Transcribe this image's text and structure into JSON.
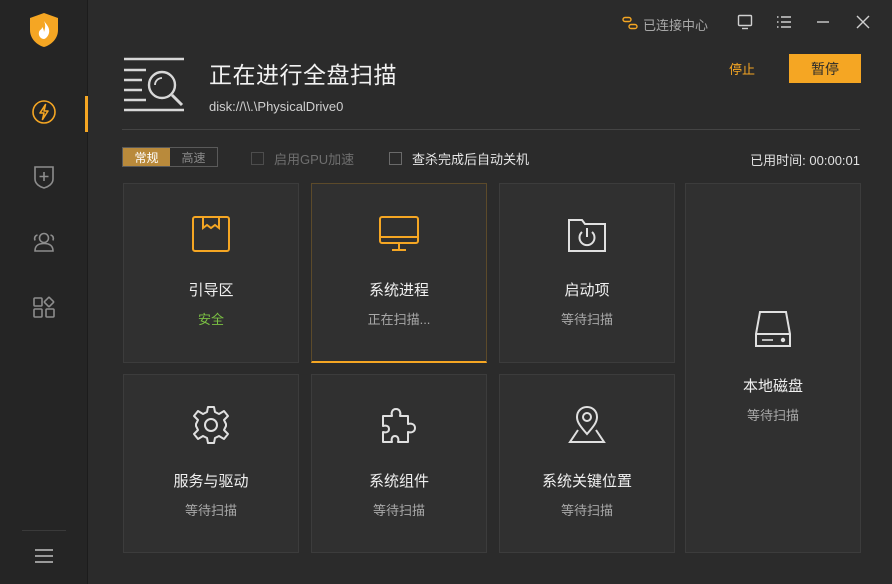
{
  "sidebar": {
    "items": [
      {
        "name": "scan",
        "icon": "lightning-icon",
        "active": true
      },
      {
        "name": "protection",
        "icon": "shield-plus-icon",
        "active": false
      },
      {
        "name": "accounts",
        "icon": "users-icon",
        "active": false
      },
      {
        "name": "tools",
        "icon": "apps-grid-icon",
        "active": false
      }
    ],
    "menu_icon": "hamburger-menu-icon"
  },
  "topbar": {
    "connect_label": "已连接中心"
  },
  "header": {
    "title": "正在进行全盘扫描",
    "path": "disk://\\\\.\\PhysicalDrive0",
    "stop_label": "停止",
    "pause_label": "暂停"
  },
  "options": {
    "modes": [
      "常规",
      "高速"
    ],
    "selected_mode": "常规",
    "gpu_label": "启用GPU加速",
    "shutdown_label": "查杀完成后自动关机",
    "elapsed_label": "已用时间:",
    "elapsed_value": "00:00:01"
  },
  "cards": [
    {
      "key": "boot",
      "name": "引导区",
      "status": "安全",
      "icon": "boot-sector-icon"
    },
    {
      "key": "process",
      "name": "系统进程",
      "status": "正在扫描...",
      "icon": "monitor-icon"
    },
    {
      "key": "startup",
      "name": "启动项",
      "status": "等待扫描",
      "icon": "power-folder-icon"
    },
    {
      "key": "local_disk",
      "name": "本地磁盘",
      "status": "等待扫描",
      "icon": "hard-drive-icon"
    },
    {
      "key": "services",
      "name": "服务与驱动",
      "status": "等待扫描",
      "icon": "gear-icon"
    },
    {
      "key": "components",
      "name": "系统组件",
      "status": "等待扫描",
      "icon": "puzzle-icon"
    },
    {
      "key": "locations",
      "name": "系统关键位置",
      "status": "等待扫描",
      "icon": "map-pin-icon"
    }
  ],
  "colors": {
    "accent": "#f5a623",
    "safe": "#7bc043",
    "background": "#2b2b2b"
  }
}
